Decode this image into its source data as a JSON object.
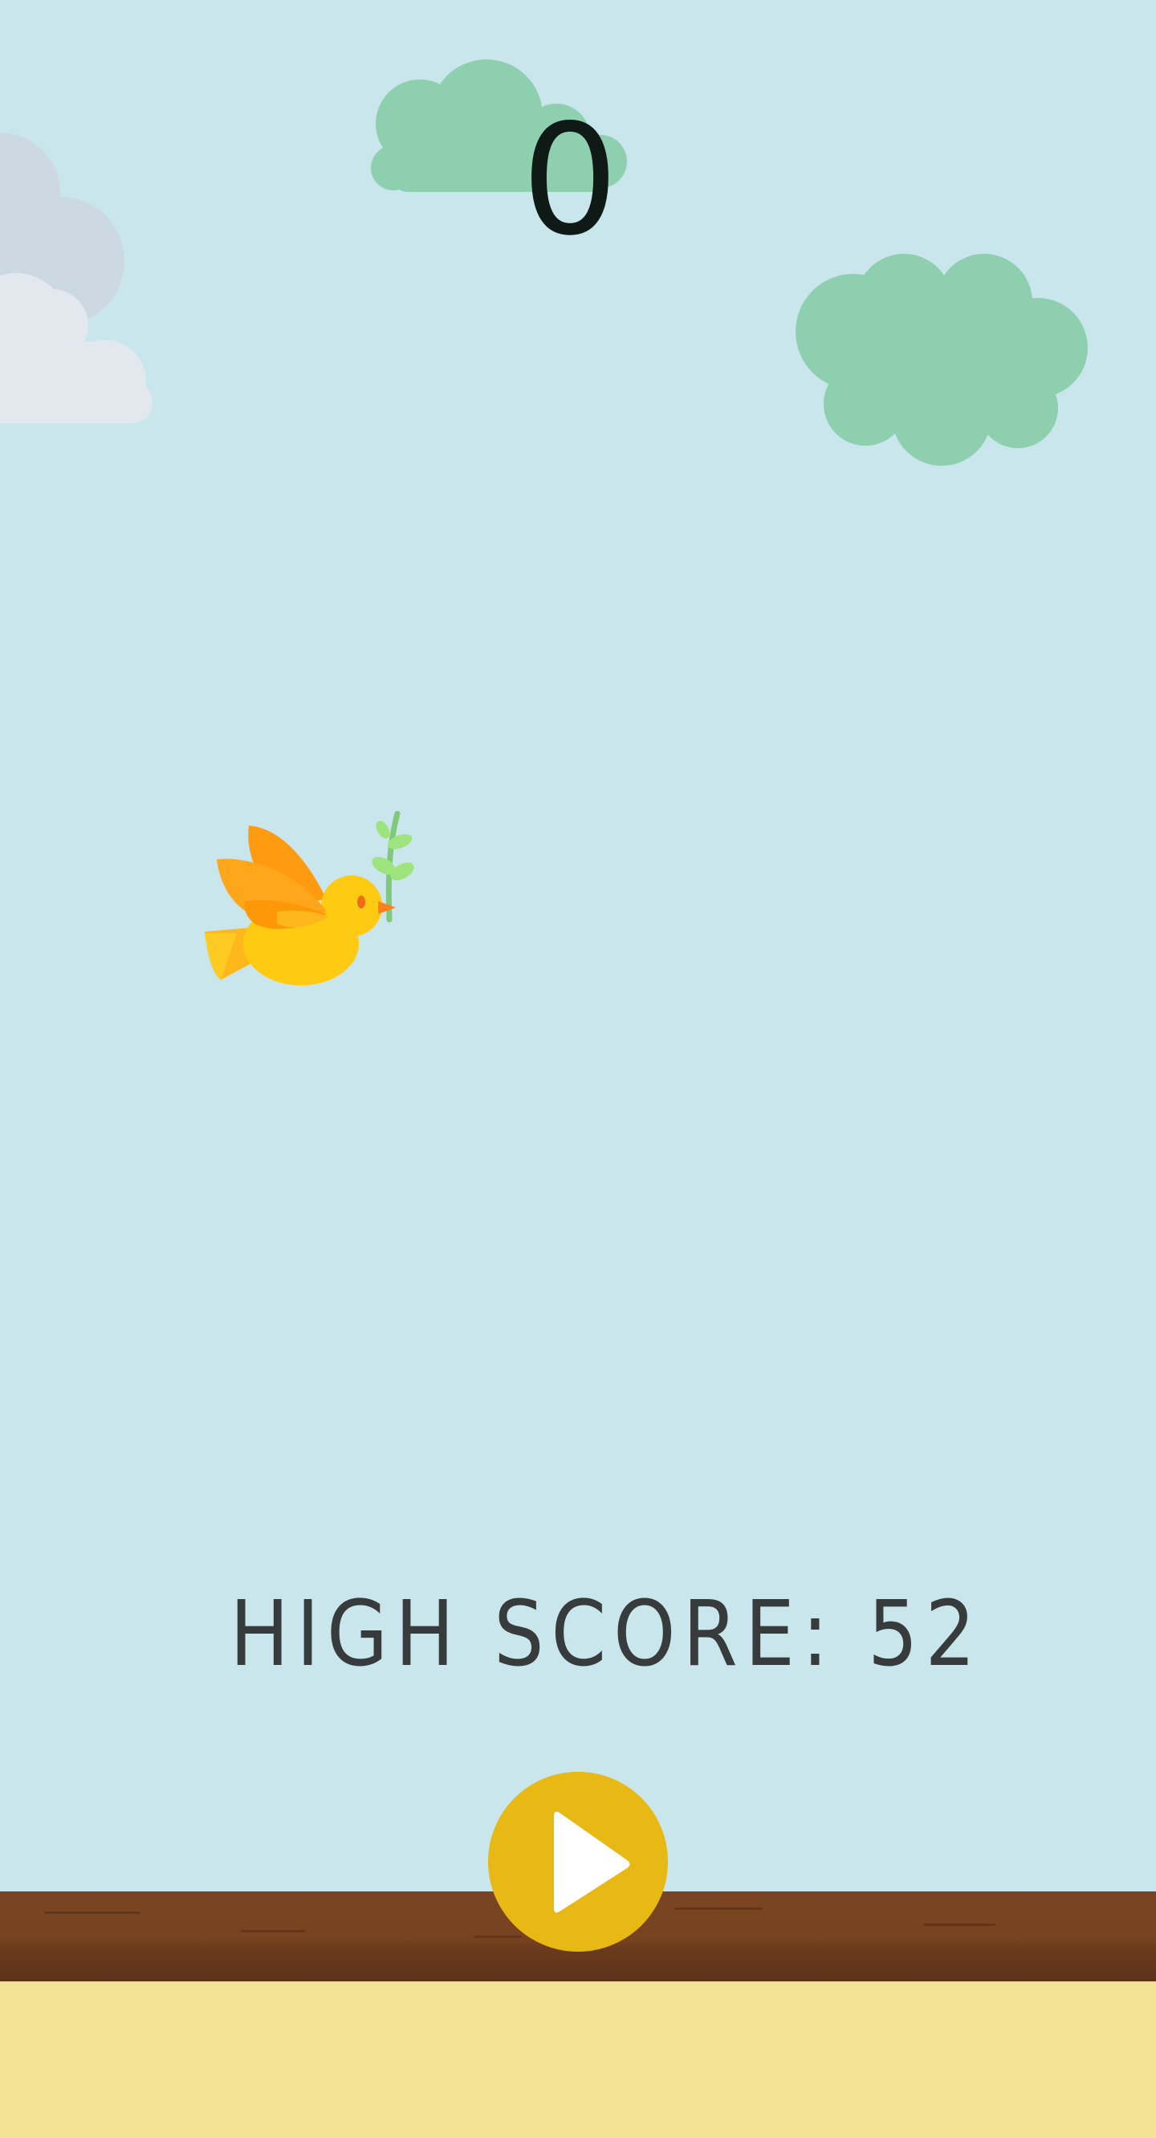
{
  "game": {
    "score": "0",
    "high_score_label": "HIGH SCORE: 52"
  },
  "icons": {
    "bird": "bird-with-olive-branch-icon",
    "play": "play-icon",
    "cloud": "cloud-icon"
  },
  "colors": {
    "sky": "#c8e6eb",
    "green_cloud": "#8ecfb0",
    "gray_cloud": "#ccd9e0",
    "white_cloud": "#e2e8ee",
    "ground_dirt": "#77431f",
    "ground_sand": "#f2e294",
    "play_button": "#e8b814",
    "score_text": "#0f1a17",
    "high_score_text": "#383b3b"
  }
}
